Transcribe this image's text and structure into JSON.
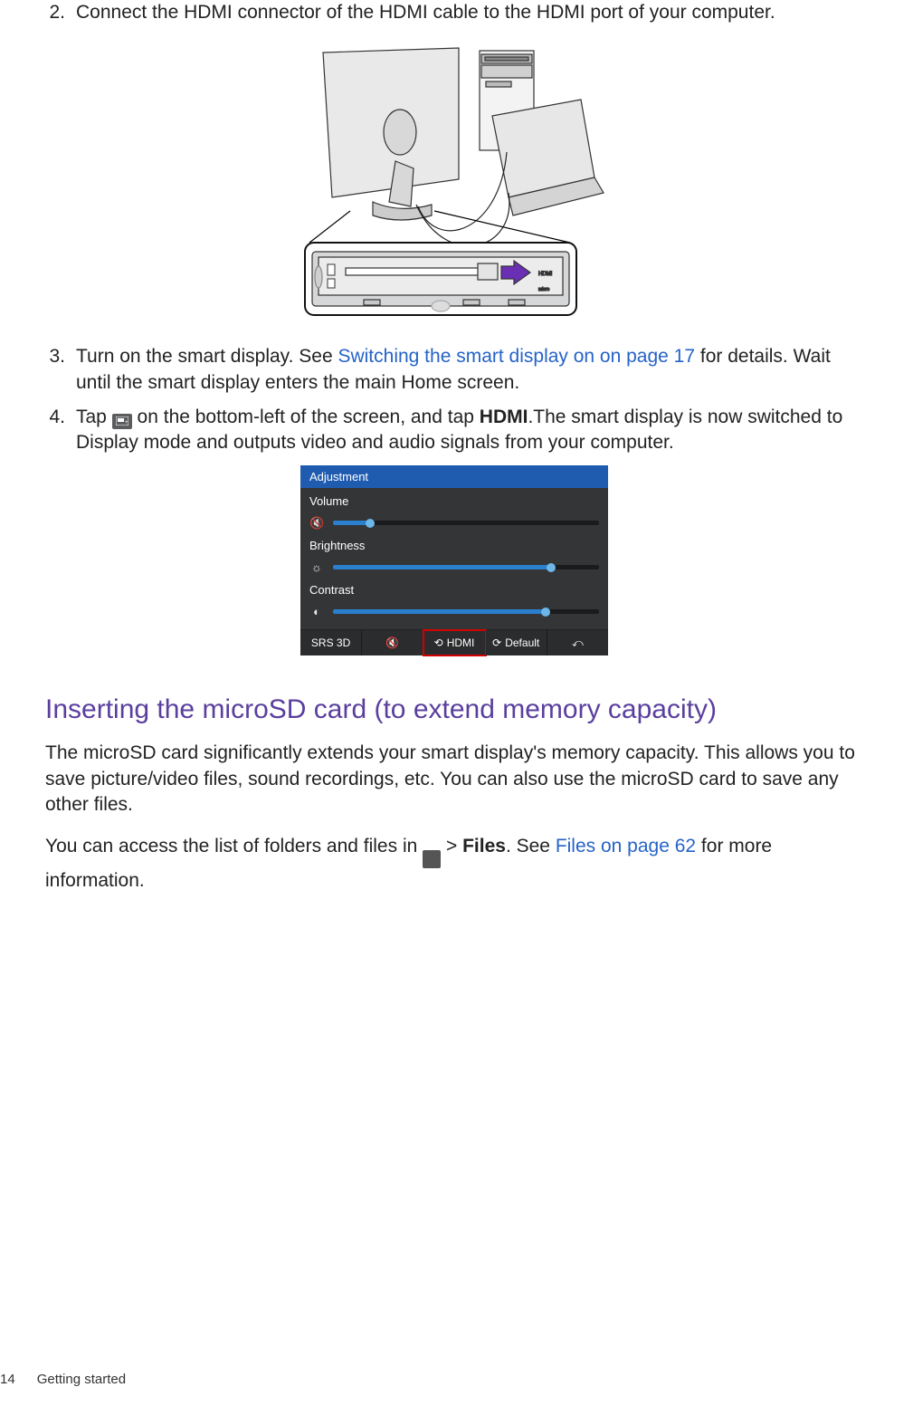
{
  "steps": {
    "s2": {
      "num": "2.",
      "text": "Connect the HDMI connector of the HDMI cable to the HDMI port of your computer."
    },
    "s3": {
      "num": "3.",
      "text_a": "Turn on the smart display. See ",
      "link": "Switching the smart display on on page 17",
      "text_b": " for details. Wait until the smart display enters the main Home screen."
    },
    "s4": {
      "num": "4.",
      "text_a": " Tap ",
      "text_b": " on the bottom-left of the screen, and tap ",
      "hdmi": "HDMI",
      "text_c": ".The smart display is now switched to Display mode and outputs video and audio signals from your computer."
    }
  },
  "osd": {
    "title": "Adjustment",
    "volume": {
      "label": "Volume",
      "icon": "🔇",
      "pct": 14
    },
    "brightness": {
      "label": "Brightness",
      "icon": "☼",
      "pct": 82
    },
    "contrast": {
      "label": "Contrast",
      "icon": "◐",
      "pct": 80
    },
    "bottom": {
      "srs": "SRS 3D",
      "mute": "🔇",
      "hdmi_icon": "⟲",
      "hdmi": "HDMI",
      "default_icon": "⟳",
      "default": "Default",
      "back": "⤺"
    }
  },
  "heading": "Inserting the microSD card (to extend memory capacity)",
  "para1": "The microSD card significantly extends your smart display's memory capacity. This allows you to save picture/video files, sound recordings, etc. You can also use the microSD card to save any other files.",
  "para2": {
    "a": "You can access the list of folders and files in ",
    "b": " > ",
    "files": "Files",
    "c": ". See ",
    "link": "Files on page 62",
    "d": " for more information."
  },
  "footer": {
    "page": "14",
    "section": "Getting started"
  }
}
